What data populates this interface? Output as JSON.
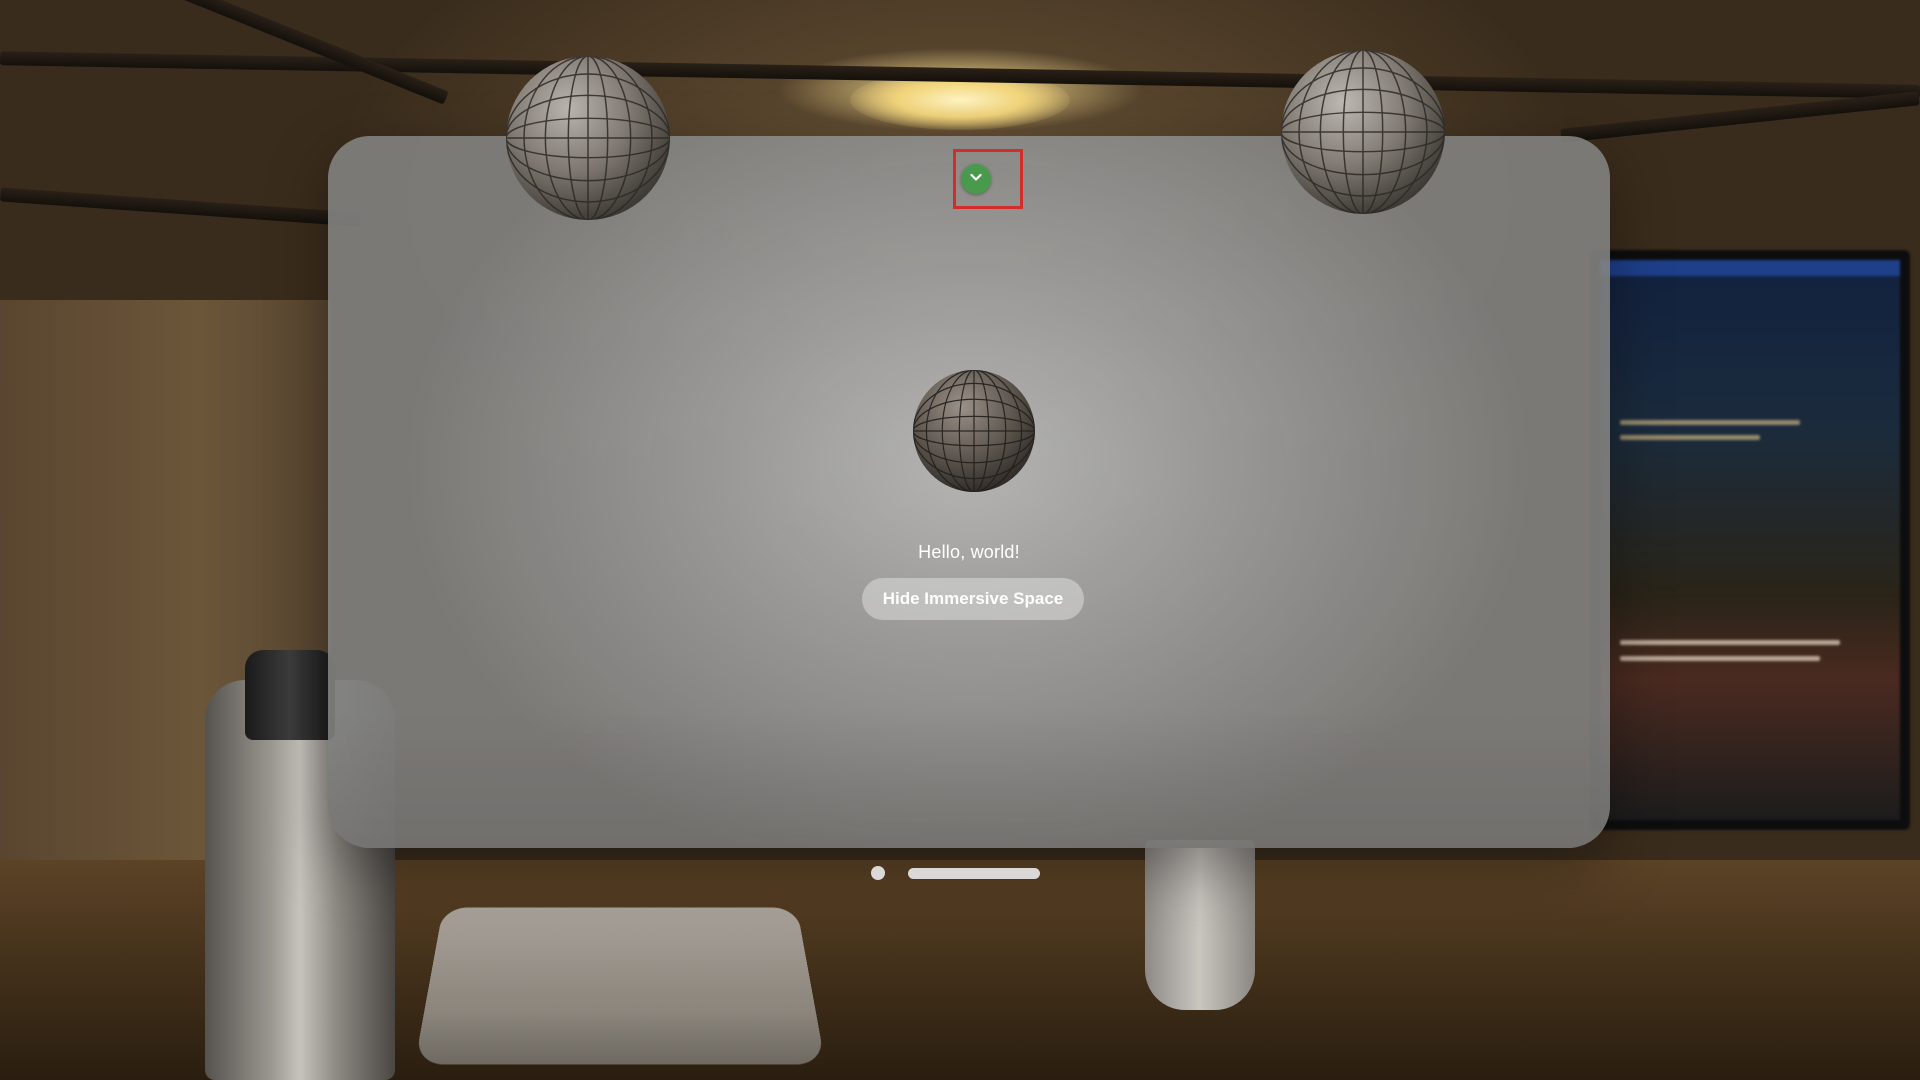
{
  "environment": {
    "description_icons": [
      "ceiling-lamp",
      "mac-mini",
      "water-bottle",
      "desktop-monitor"
    ]
  },
  "app_window": {
    "greeting": "Hello, world!",
    "hide_button_label": "Hide Immersive Space",
    "toolbar_button_icon": "chevron-down-icon",
    "toolbar_button_color": "#4a9a4e",
    "highlight_color": "#d42b2b",
    "sphere_color": "#6f6a63"
  }
}
